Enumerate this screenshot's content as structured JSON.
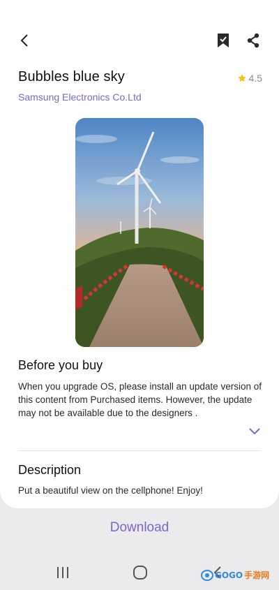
{
  "header": {
    "back_icon": "chevron-left-icon",
    "bookmark_icon": "bookmark-icon",
    "share_icon": "share-icon"
  },
  "product": {
    "title": "Bubbles blue sky",
    "rating": "4.5",
    "star_icon": "star-icon",
    "star_color": "#f2c21b",
    "publisher": "Samsung Electronics Co.Ltd",
    "publisher_color": "#7b68c6"
  },
  "preview": {
    "image_icon": "wind-turbine-road-image"
  },
  "before_you_buy": {
    "title": "Before you buy",
    "text": "When you upgrade OS, please install an update version of this content from Purchased items. However, the update may not be available due to the designers .",
    "expand_icon": "chevron-down-icon"
  },
  "description": {
    "title": "Description",
    "text": "Put a beautiful view on the cellphone! Enjoy!"
  },
  "actions": {
    "download_label": "Download"
  },
  "navbar": {
    "recent_icon": "recent-apps-icon",
    "home_icon": "home-icon",
    "back_icon": "back-icon"
  },
  "watermark": {
    "brand": "GOGO",
    "suffix": "手游网"
  }
}
